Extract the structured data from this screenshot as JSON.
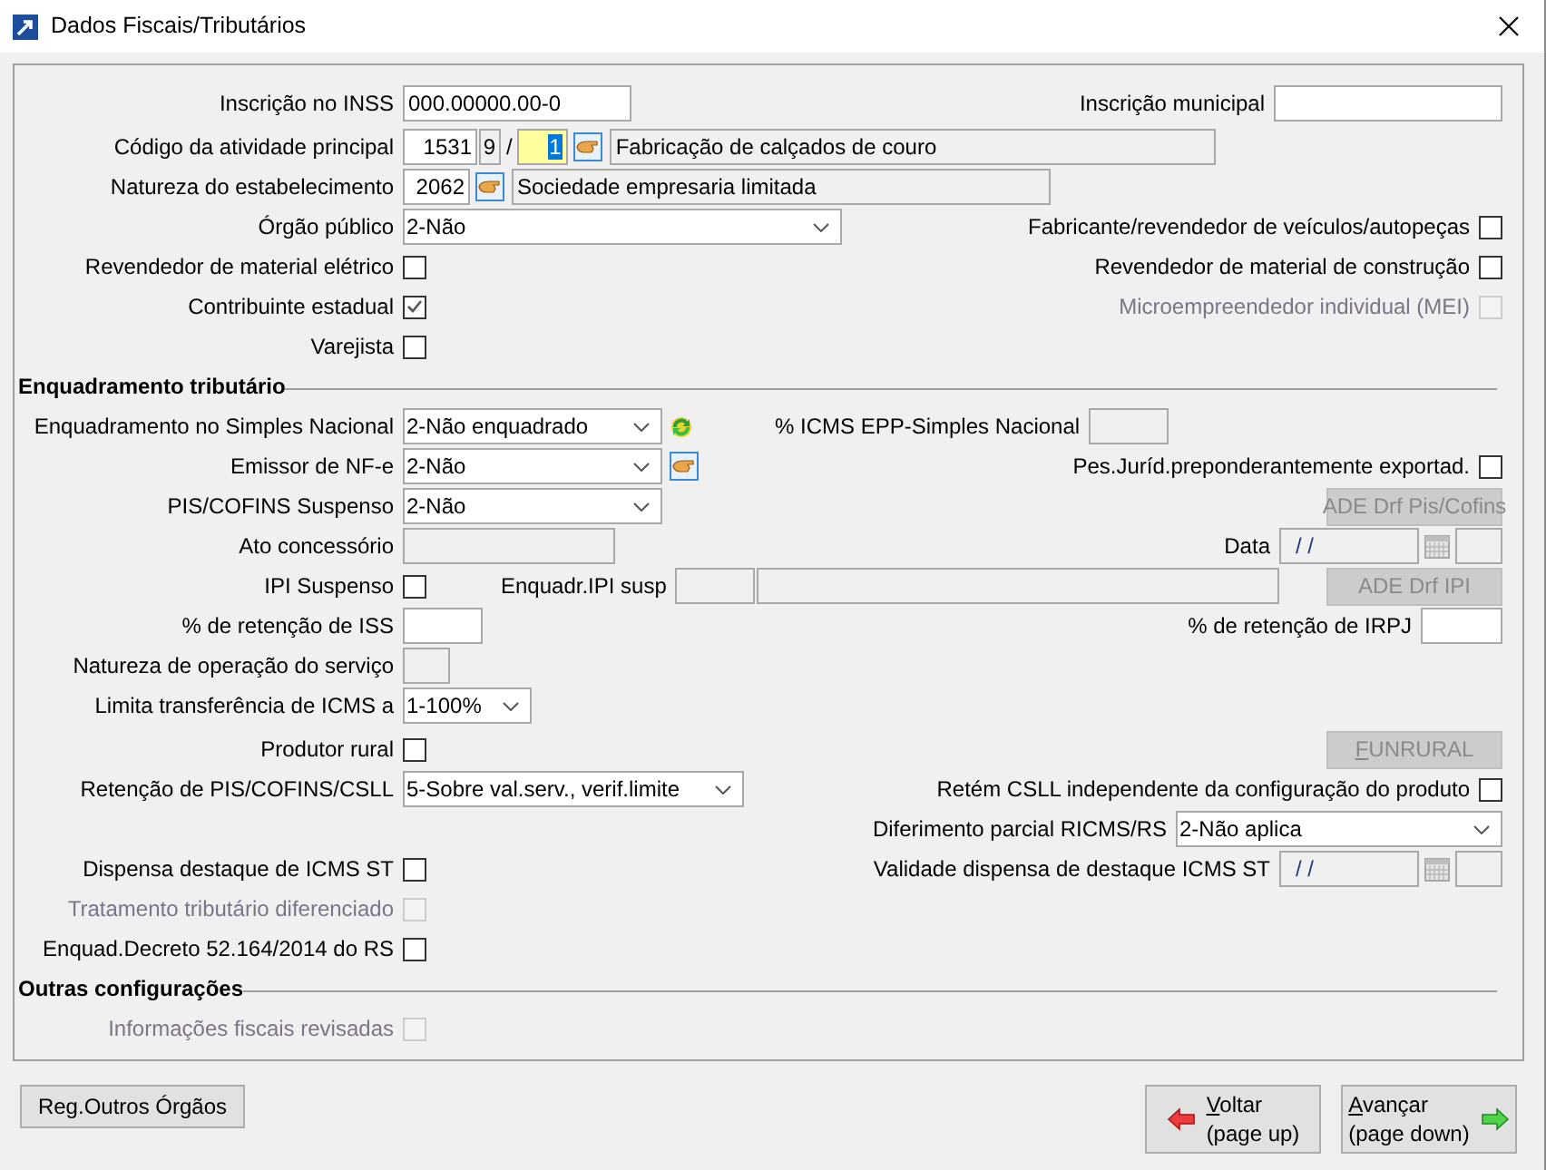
{
  "window": {
    "title": "Dados Fiscais/Tributários"
  },
  "identification": {
    "inss": {
      "label": "Inscrição no INSS",
      "value": "000.00000.00-0"
    },
    "municipal": {
      "label": "Inscrição municipal"
    },
    "activity": {
      "label": "Código da atividade principal",
      "code": "1531",
      "check_digit": "9",
      "separator": "/",
      "sequence": "1",
      "description": "Fabricação de calçados de couro"
    },
    "establishment": {
      "label": "Natureza do estabelecimento",
      "code": "2062",
      "description": "Sociedade empresaria limitada"
    },
    "public_body": {
      "label": "Órgão público",
      "value": "2-Não"
    }
  },
  "flags_left": [
    {
      "label": "Revendedor de material elétrico",
      "checked": false,
      "disabled": false
    },
    {
      "label": "Contribuinte estadual",
      "checked": true,
      "disabled": false
    },
    {
      "label": "Varejista",
      "checked": false,
      "disabled": false
    }
  ],
  "flags_right": [
    {
      "label": "Fabricante/revendedor de veículos/autopeças",
      "checked": false,
      "disabled": false
    },
    {
      "label": "Revendedor de material de construção",
      "checked": false,
      "disabled": false
    },
    {
      "label": "Microempreendedor individual (MEI)",
      "checked": false,
      "disabled": true
    }
  ],
  "tax": {
    "title": "Enquadramento tributário",
    "simples": {
      "label": "Enquadramento no Simples Nacional",
      "value": "2-Não enquadrado"
    },
    "icms_epp": {
      "label": "% ICMS EPP-Simples Nacional"
    },
    "nfe": {
      "label": "Emissor de NF-e",
      "value": "2-Não"
    },
    "exporter": {
      "label": "Pes.Juríd.preponderantemente exportad.",
      "checked": false,
      "disabled": false
    },
    "pis_cofins": {
      "label": "PIS/COFINS Suspenso",
      "value": "2-Não"
    },
    "ade_pis": {
      "label": "ADE Drf Pis/Cofins",
      "disabled": true,
      "mnemonic": false
    },
    "ato": {
      "label": "Ato concessório"
    },
    "date": {
      "label": "Data",
      "value": "/ /"
    },
    "ipi": {
      "label": "IPI Suspenso",
      "checked": false,
      "disabled": false
    },
    "ipi_framing": {
      "label": "Enquadr.IPI susp"
    },
    "ade_ipi": {
      "label": "ADE Drf IPI",
      "disabled": true,
      "mnemonic": false
    },
    "iss": {
      "label": "% de retenção de ISS"
    },
    "irpj": {
      "label": "% de retenção de IRPJ"
    },
    "service_nature": {
      "label": "Natureza de operação do serviço"
    },
    "icms_limit": {
      "label": "Limita transferência de ICMS a",
      "value": "1-100%"
    },
    "rural": {
      "label": "Produtor rural",
      "checked": false,
      "disabled": false
    },
    "funrural": {
      "label": "FUNRURAL",
      "disabled": true,
      "mnemonic": true
    },
    "retention": {
      "label": "Retenção de PIS/COFINS/CSLL",
      "value": "5-Sobre val.serv., verif.limite"
    },
    "csll": {
      "label": "Retém CSLL independente da configuração do produto",
      "checked": false,
      "disabled": false
    },
    "deferral": {
      "label": "Diferimento parcial RICMS/RS",
      "value": "2-Não aplica"
    },
    "st_waiver": {
      "label": "Dispensa destaque de ICMS ST",
      "checked": false,
      "disabled": false
    },
    "st_validity": {
      "label": "Validade dispensa de destaque ICMS ST",
      "value": "/ /"
    },
    "differentiated": {
      "label": "Tratamento tributário diferenciado",
      "checked": false,
      "disabled": true
    },
    "decree": {
      "label": "Enquad.Decreto 52.164/2014 do RS",
      "checked": false,
      "disabled": false
    }
  },
  "other": {
    "title": "Outras configurações",
    "reviewed": {
      "label": "Informações fiscais revisadas",
      "checked": false,
      "disabled": true
    }
  },
  "buttons": [
    {
      "kind": "plain",
      "label": "Reg.Outros Órgãos",
      "mnemonic": false
    },
    {
      "kind": "back",
      "label": "Voltar",
      "hint": "(page up)",
      "mnemonic": true
    },
    {
      "kind": "forward",
      "label": "Avançar",
      "hint": "(page down)",
      "mnemonic": true
    }
  ]
}
